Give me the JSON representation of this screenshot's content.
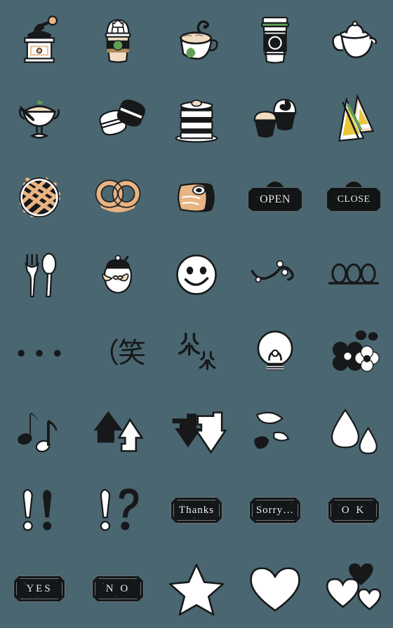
{
  "app": {
    "type": "emoji-sticker-pack-preview",
    "background_color": "#4a6670",
    "grid": {
      "columns": 5,
      "rows": 8,
      "total": 40
    }
  },
  "palette": {
    "background": "#4a6670",
    "ink": "#16181a",
    "paper": "#ffffff",
    "cream": "#f0dcc0",
    "tan": "#e8b483",
    "green": "#5f9e55",
    "yellow": "#e8c73c"
  },
  "stickers": [
    {
      "index": 1,
      "name": "coffee-grinder",
      "label": "Coffee grinder",
      "row": 1,
      "col": 1
    },
    {
      "index": 2,
      "name": "frappuccino-cup",
      "label": "Frappuccino cup",
      "row": 1,
      "col": 2
    },
    {
      "index": 3,
      "name": "latte-cup",
      "label": "Hot latte cup",
      "row": 1,
      "col": 3
    },
    {
      "index": 4,
      "name": "takeaway-coffee-cup",
      "label": "Takeaway coffee cup",
      "row": 1,
      "col": 4
    },
    {
      "index": 5,
      "name": "teapot",
      "label": "Teapot",
      "row": 1,
      "col": 5
    },
    {
      "index": 6,
      "name": "ice-cream-sundae",
      "label": "Ice cream sundae",
      "row": 2,
      "col": 1
    },
    {
      "index": 7,
      "name": "macarons",
      "label": "Macarons",
      "row": 2,
      "col": 2
    },
    {
      "index": 8,
      "name": "layer-cake",
      "label": "Layer cake",
      "row": 2,
      "col": 3
    },
    {
      "index": 9,
      "name": "cupcakes",
      "label": "Cupcakes",
      "row": 2,
      "col": 4
    },
    {
      "index": 10,
      "name": "sandwich",
      "label": "Sandwich",
      "row": 2,
      "col": 5
    },
    {
      "index": 11,
      "name": "lattice-pie",
      "label": "Lattice pie",
      "row": 3,
      "col": 1
    },
    {
      "index": 12,
      "name": "pretzel",
      "label": "Pretzel",
      "row": 3,
      "col": 2
    },
    {
      "index": 13,
      "name": "bread-roll",
      "label": "Bread roll",
      "row": 3,
      "col": 3
    },
    {
      "index": 14,
      "name": "open-sign",
      "label": "OPEN sign",
      "row": 3,
      "col": 4,
      "text": "OPEN"
    },
    {
      "index": 15,
      "name": "close-sign",
      "label": "CLOSE sign",
      "row": 3,
      "col": 5,
      "text": "CLOSE"
    },
    {
      "index": 16,
      "name": "fork-and-spoon",
      "label": "Fork and spoon",
      "row": 4,
      "col": 1
    },
    {
      "index": 17,
      "name": "sugar-pot",
      "label": "Sugar pot with ribbon",
      "row": 4,
      "col": 2
    },
    {
      "index": 18,
      "name": "smiley-face",
      "label": "Smiley face",
      "row": 4,
      "col": 3
    },
    {
      "index": 19,
      "name": "sparkle-swirl",
      "label": "Swirl with sparkles",
      "row": 4,
      "col": 4
    },
    {
      "index": 20,
      "name": "triple-loop",
      "label": "Three loops",
      "row": 4,
      "col": 5
    },
    {
      "index": 21,
      "name": "ellipsis-dots",
      "label": "Three dots",
      "row": 5,
      "col": 1
    },
    {
      "index": 22,
      "name": "warai-text",
      "label": "(笑 laugh text",
      "row": 5,
      "col": 2,
      "text": "（笑"
    },
    {
      "index": 23,
      "name": "sparkles",
      "label": "Sparkles",
      "row": 5,
      "col": 3
    },
    {
      "index": 24,
      "name": "lightbulb",
      "label": "Light bulb",
      "row": 5,
      "col": 4
    },
    {
      "index": 25,
      "name": "flowers",
      "label": "Flowers",
      "row": 5,
      "col": 5
    },
    {
      "index": 26,
      "name": "music-notes",
      "label": "Music notes",
      "row": 6,
      "col": 1
    },
    {
      "index": 27,
      "name": "up-arrows",
      "label": "Up arrows",
      "row": 6,
      "col": 2
    },
    {
      "index": 28,
      "name": "down-arrows",
      "label": "Down arrows",
      "row": 6,
      "col": 3
    },
    {
      "index": 29,
      "name": "petals",
      "label": "Falling petals",
      "row": 6,
      "col": 4
    },
    {
      "index": 30,
      "name": "water-drops",
      "label": "Water drops",
      "row": 6,
      "col": 5
    },
    {
      "index": 31,
      "name": "double-exclamation",
      "label": "Double exclamation",
      "row": 7,
      "col": 1
    },
    {
      "index": 32,
      "name": "interrobang",
      "label": "Exclamation question",
      "row": 7,
      "col": 2
    },
    {
      "index": 33,
      "name": "thanks-sign",
      "label": "Thanks plaque",
      "row": 7,
      "col": 3,
      "text": "Thanks"
    },
    {
      "index": 34,
      "name": "sorry-sign",
      "label": "Sorry plaque",
      "row": 7,
      "col": 4,
      "text": "Sorry…"
    },
    {
      "index": 35,
      "name": "ok-sign",
      "label": "OK plaque",
      "row": 7,
      "col": 5,
      "text": "O K"
    },
    {
      "index": 36,
      "name": "yes-sign",
      "label": "YES plaque",
      "row": 8,
      "col": 1,
      "text": "YES"
    },
    {
      "index": 37,
      "name": "no-sign",
      "label": "NO plaque",
      "row": 8,
      "col": 2,
      "text": "N O"
    },
    {
      "index": 38,
      "name": "star",
      "label": "Star",
      "row": 8,
      "col": 3
    },
    {
      "index": 39,
      "name": "heart",
      "label": "Heart",
      "row": 8,
      "col": 4
    },
    {
      "index": 40,
      "name": "three-hearts",
      "label": "Three hearts",
      "row": 8,
      "col": 5
    }
  ]
}
